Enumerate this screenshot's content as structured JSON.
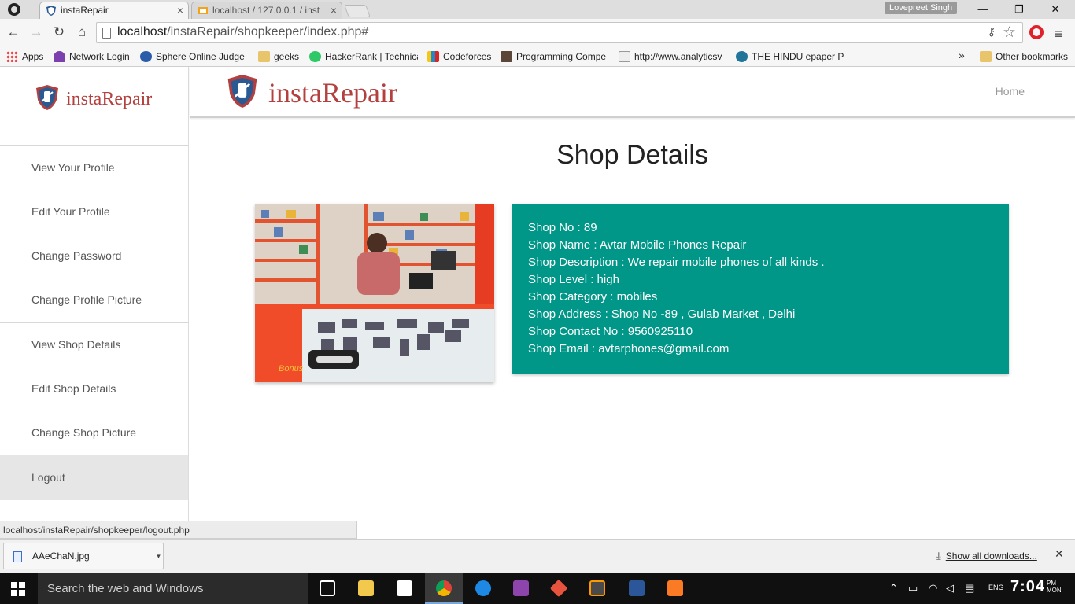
{
  "browser": {
    "tabs": [
      {
        "title": "instaRepair",
        "active": true
      },
      {
        "title": "localhost / 127.0.0.1 / inst",
        "active": false
      }
    ],
    "user": "Lovepreet Singh",
    "url_host": "localhost",
    "url_path": "/instaRepair/shopkeeper/index.php#",
    "bookmarks": [
      "Apps",
      "Network Login",
      "Sphere Online Judge",
      "geeks",
      "HackerRank | Technica",
      "Codeforces",
      "Programming Compe",
      "http://www.analyticsv",
      "THE HINDU epaper PI"
    ],
    "bookmarks_overflow": "»",
    "other_bookmarks": "Other bookmarks"
  },
  "site": {
    "brand": "instaRepair",
    "nav_home": "Home"
  },
  "sidebar": {
    "items": [
      "View Your Profile",
      "Edit Your Profile",
      "Change Password",
      "Change Profile Picture",
      "View Shop Details",
      "Edit Shop Details",
      "Change Shop Picture",
      "Logout"
    ]
  },
  "content": {
    "title": "Shop Details",
    "photo_text": "Bonus",
    "details": [
      "Shop No : 89",
      "Shop Name : Avtar Mobile Phones Repair",
      "Shop Description : We repair mobile phones of all kinds .",
      "Shop Level : high",
      "Shop Category : mobiles",
      "Shop Address : Shop No -89 , Gulab Market , Delhi",
      "Shop Contact No : 9560925110",
      "Shop Email : avtarphones@gmail.com"
    ],
    "card_color": "#009688"
  },
  "status_bar": "localhost/instaRepair/shopkeeper/logout.php",
  "downloads": {
    "file": "AAeChaN.jpg",
    "show_all": "Show all downloads..."
  },
  "taskbar": {
    "search_placeholder": "Search the web and Windows",
    "time": "7:04",
    "ampm": "PM",
    "day": "MON"
  }
}
